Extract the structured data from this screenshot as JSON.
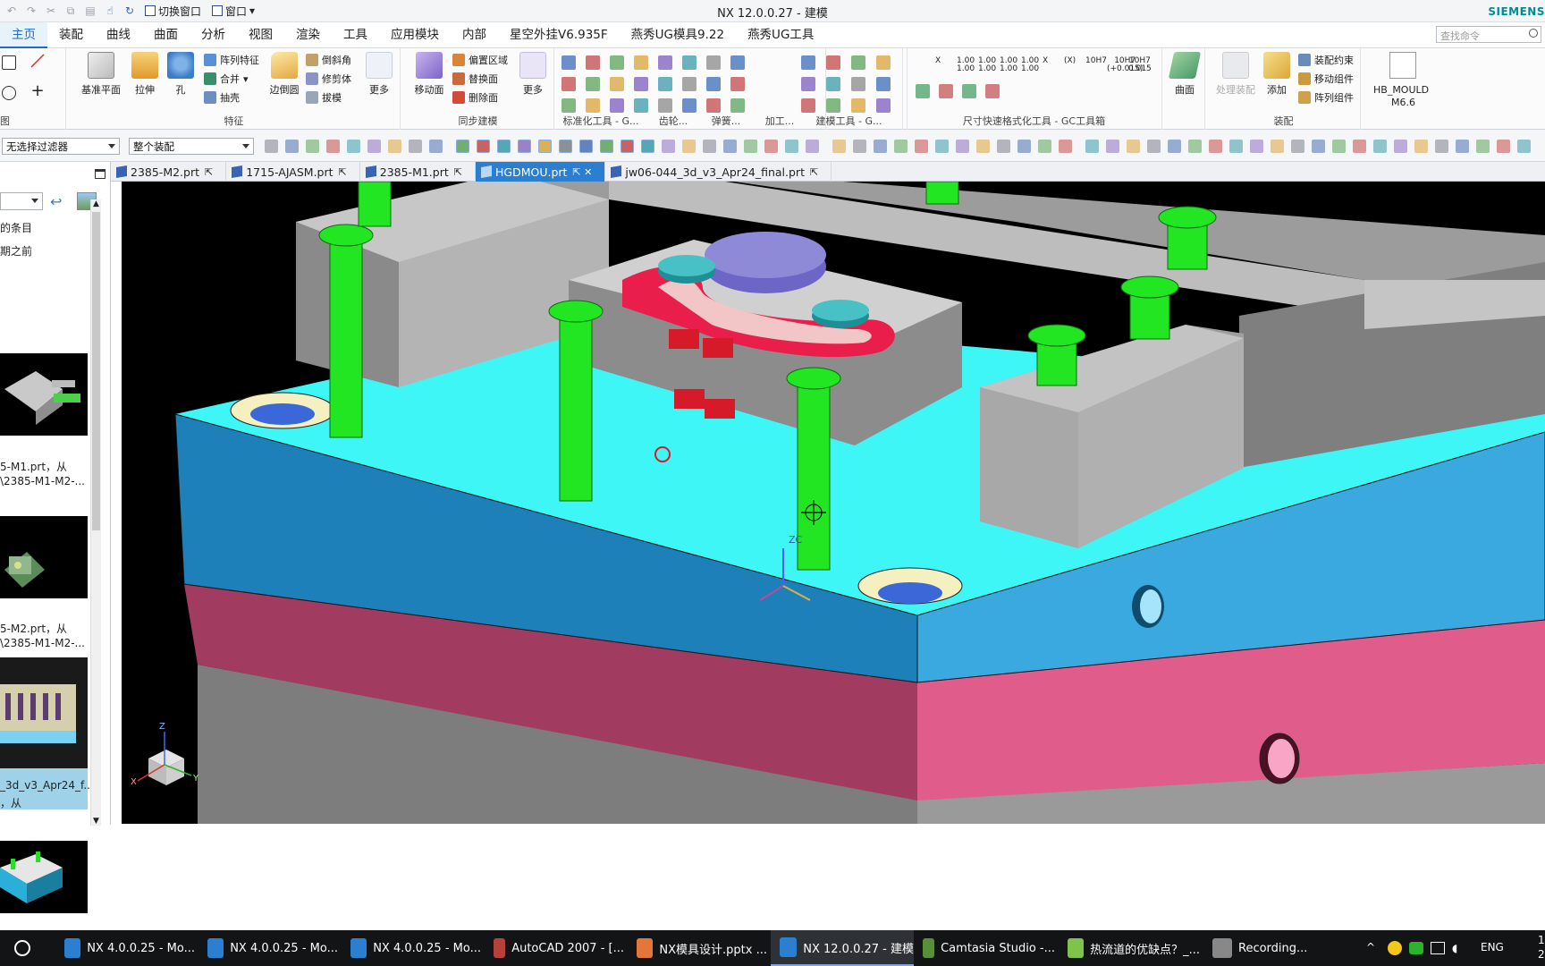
{
  "window": {
    "title": "NX 12.0.0.27 - 建模",
    "brand": "SIEMENS",
    "switch_window_label": "切换窗口",
    "window_menu_label": "窗口"
  },
  "menu": {
    "tabs": [
      "主页",
      "装配",
      "曲线",
      "曲面",
      "分析",
      "视图",
      "渲染",
      "工具",
      "应用模块",
      "内部",
      "星空外挂V6.935F",
      "燕秀UG模具9.22",
      "燕秀UG工具"
    ],
    "active_index": 0,
    "search_placeholder": "查找命令"
  },
  "ribbon": {
    "feature": {
      "datum_plane": "基准平面",
      "extrude": "拉伸",
      "hole": "孔",
      "pattern_feature": "阵列特征",
      "unite": "合并",
      "shell": "抽壳",
      "edge_blend": "边倒圆",
      "chamfer": "倒斜角",
      "trim_body": "修剪体",
      "draft": "拔模",
      "more": "更多",
      "group_title": "特征",
      "left_group_title": "图"
    },
    "sync": {
      "move_face": "移动面",
      "offset_region": "偏置区域",
      "replace_face": "替换面",
      "delete_face": "删除面",
      "more": "更多",
      "group_title": "同步建模"
    },
    "std_tools_title": "标准化工具 - G...",
    "gear_title": "齿轮...",
    "spring_title": "弹簧...",
    "machining_title": "加工...",
    "modeling_tools_title": "建模工具 - G...",
    "arrow_title": ">...",
    "dim_tools_title": "尺寸快速格式化工具 - GC工具箱",
    "surface_label": "曲面",
    "assembly": {
      "process_asm": "处理装配",
      "add": "添加",
      "assembly_constraints": "装配约束",
      "move_component": "移动组件",
      "pattern_component": "阵列组件",
      "group_title": "装配"
    },
    "hb_mould": "HB_MOULD",
    "hb_version": "M6.6",
    "dim_labels": [
      "X",
      "1.00\n1.00",
      "1.00\n1.00",
      "1.00\n1.00",
      "1.00\n1.00",
      "X",
      "(X)",
      "10H7",
      "10H7\n(+0.015)",
      "10H7\n0.015"
    ]
  },
  "filterbar": {
    "selection_filter": "无选择过滤器",
    "assembly_scope": "整个装配"
  },
  "navigator": {
    "line1": "的条目",
    "line2": "期之前",
    "items": [
      {
        "name": "5-M1.prt，从",
        "path": "\\2385-M1-M2-..."
      },
      {
        "name": "5-M2.prt，从",
        "path": "\\2385-M1-M2-..."
      },
      {
        "name": "_3d_v3_Apr24_f...",
        "path": "，从"
      }
    ]
  },
  "doc_tabs": [
    {
      "label": "2385-M2.prt",
      "active": false
    },
    {
      "label": "1715-AJASM.prt",
      "active": false
    },
    {
      "label": "2385-M1.prt",
      "active": false
    },
    {
      "label": "HGDMOU.prt",
      "active": true
    },
    {
      "label": "jw06-044_3d_v3_Apr24_final.prt",
      "active": false
    }
  ],
  "viewport": {
    "zc_label": "ZC",
    "triad": {
      "z": "Z",
      "x": "X",
      "y": "Y"
    },
    "colors": {
      "background": "#000000",
      "plate_cyan_top": "#3ff6f6",
      "plate_blue_front": "#1e80b8",
      "plate_blue_side": "#3aa9e0",
      "plate_pink": "#b44a6e",
      "screw_green": "#22e622",
      "block_grey": "#b8b8b8"
    }
  },
  "taskbar": {
    "items": [
      {
        "label": "NX 4.0.0.25 - Mo...",
        "active": false
      },
      {
        "label": "NX 4.0.0.25 - Mo...",
        "active": false
      },
      {
        "label": "NX 4.0.0.25 - Mo...",
        "active": false
      },
      {
        "label": "AutoCAD 2007 - [...",
        "active": false
      },
      {
        "label": "NX模具设计.pptx ...",
        "active": false
      },
      {
        "label": "NX 12.0.0.27 - 建模",
        "active": true
      },
      {
        "label": "Camtasia Studio -...",
        "active": false
      },
      {
        "label": "热流道的优缺点？_...",
        "active": false
      },
      {
        "label": "Recording...",
        "active": false
      }
    ],
    "lang": "ENG",
    "clock_a": "1",
    "clock_b": "2"
  }
}
